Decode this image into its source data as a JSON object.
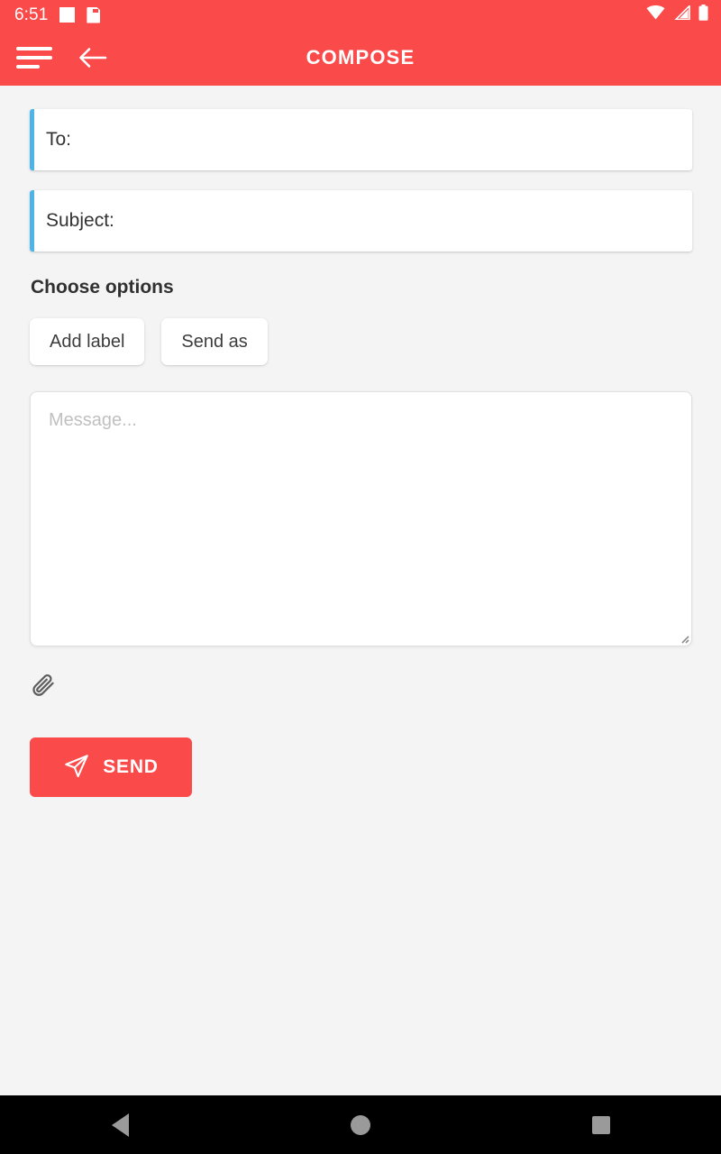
{
  "status_bar": {
    "time": "6:51",
    "icons": [
      "white-square-icon",
      "sd-card-icon",
      "wifi-icon",
      "cell-signal-icon",
      "battery-icon"
    ],
    "background_color": "#fb4a4a"
  },
  "app_bar": {
    "title": "COMPOSE",
    "menu_icon": "hamburger-menu-icon",
    "back_icon": "back-arrow-icon",
    "background_color": "#fb4a4a",
    "title_color": "#ffffff"
  },
  "form": {
    "accent_color": "#4eb3e8",
    "to": {
      "label": "To:",
      "value": "",
      "placeholder": ""
    },
    "subject": {
      "label": "Subject:",
      "value": "",
      "placeholder": ""
    },
    "options": {
      "title": "Choose options",
      "buttons": [
        {
          "label": "Add label"
        },
        {
          "label": "Send as"
        }
      ]
    },
    "message": {
      "value": "",
      "placeholder": "Message..."
    },
    "attachment": {
      "icon": "paperclip-icon"
    },
    "send": {
      "label": "SEND",
      "icon": "send-paper-plane-icon",
      "background_color": "#fb4a4a"
    }
  },
  "nav_bar": {
    "back_label": "back-triangle-icon",
    "home_label": "home-circle-icon",
    "recents_label": "recents-square-icon",
    "background_color": "#000000"
  }
}
